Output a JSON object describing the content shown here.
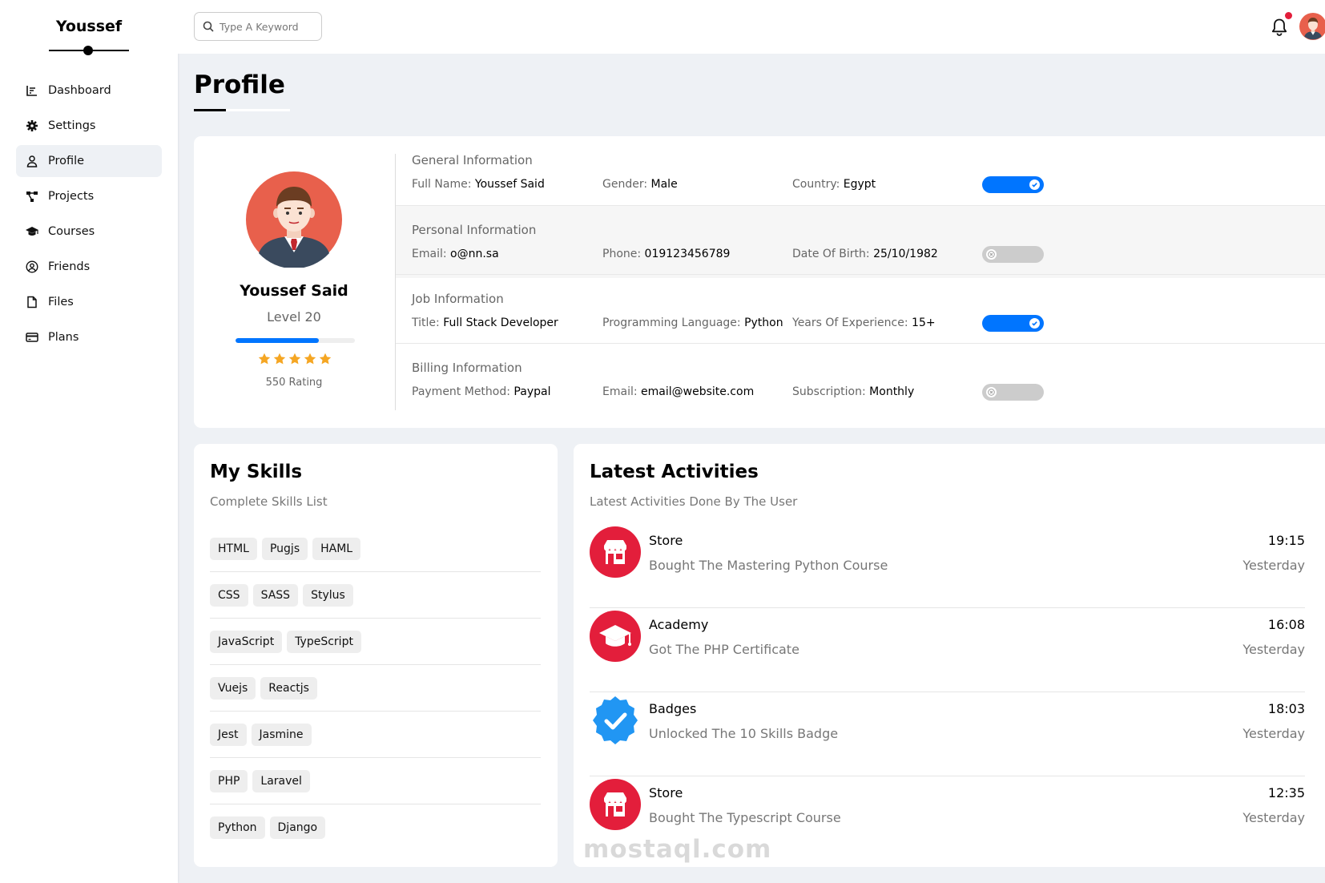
{
  "sidebar": {
    "brand": "Youssef",
    "items": [
      {
        "label": "Dashboard",
        "icon": "chart-icon"
      },
      {
        "label": "Settings",
        "icon": "gear-icon"
      },
      {
        "label": "Profile",
        "icon": "user-icon",
        "active": true
      },
      {
        "label": "Projects",
        "icon": "diagram-icon"
      },
      {
        "label": "Courses",
        "icon": "graduation-cap-icon"
      },
      {
        "label": "Friends",
        "icon": "user-circle-icon"
      },
      {
        "label": "Files",
        "icon": "file-icon"
      },
      {
        "label": "Plans",
        "icon": "credit-card-icon"
      }
    ]
  },
  "header": {
    "search_placeholder": "Type A Keyword",
    "has_notification": true
  },
  "page": {
    "title": "Profile"
  },
  "profile": {
    "name": "Youssef Said",
    "level": "Level 20",
    "level_progress": 0.7,
    "stars": 5,
    "rating": "550 Rating"
  },
  "info": {
    "general": {
      "title": "General Information",
      "items": [
        {
          "label": "Full Name:",
          "value": "Youssef Said"
        },
        {
          "label": "Gender:",
          "value": "Male"
        },
        {
          "label": "Country:",
          "value": "Egypt"
        }
      ],
      "toggle": true
    },
    "personal": {
      "title": "Personal Information",
      "items": [
        {
          "label": "Email:",
          "value": "o@nn.sa"
        },
        {
          "label": "Phone:",
          "value": "019123456789"
        },
        {
          "label": "Date Of Birth:",
          "value": "25/10/1982"
        }
      ],
      "toggle": false
    },
    "job": {
      "title": "Job Information",
      "items": [
        {
          "label": "Title:",
          "value": "Full Stack Developer"
        },
        {
          "label": "Programming Language:",
          "value": "Python"
        },
        {
          "label": "Years Of Experience:",
          "value": "15+"
        }
      ],
      "toggle": true
    },
    "billing": {
      "title": "Billing Information",
      "items": [
        {
          "label": "Payment Method:",
          "value": "Paypal"
        },
        {
          "label": "Email:",
          "value": "email@website.com"
        },
        {
          "label": "Subscription:",
          "value": "Monthly"
        }
      ],
      "toggle": false
    }
  },
  "skills": {
    "title": "My Skills",
    "subtitle": "Complete Skills List",
    "rows": [
      [
        "HTML",
        "Pugjs",
        "HAML"
      ],
      [
        "CSS",
        "SASS",
        "Stylus"
      ],
      [
        "JavaScript",
        "TypeScript"
      ],
      [
        "Vuejs",
        "Reactjs"
      ],
      [
        "Jest",
        "Jasmine"
      ],
      [
        "PHP",
        "Laravel"
      ],
      [
        "Python",
        "Django"
      ]
    ]
  },
  "activities": {
    "title": "Latest Activities",
    "subtitle": "Latest Activities Done By The User",
    "items": [
      {
        "name": "Store",
        "desc": "Bought The Mastering Python Course",
        "time": "19:15",
        "day": "Yesterday",
        "icon": "store-icon"
      },
      {
        "name": "Academy",
        "desc": "Got The PHP Certificate",
        "time": "16:08",
        "day": "Yesterday",
        "icon": "graduation-cap-icon"
      },
      {
        "name": "Badges",
        "desc": "Unlocked The 10 Skills Badge",
        "time": "18:03",
        "day": "Yesterday",
        "icon": "badge-check-icon"
      },
      {
        "name": "Store",
        "desc": "Bought The Typescript Course",
        "time": "12:35",
        "day": "Yesterday",
        "icon": "store-icon"
      }
    ]
  },
  "watermark": "mostaql.com",
  "colors": {
    "accent": "#0075ff",
    "star": "#f5a623",
    "activity_red": "#e31e3b",
    "badge_blue": "#2196f3",
    "notification": "#e31e3b"
  }
}
